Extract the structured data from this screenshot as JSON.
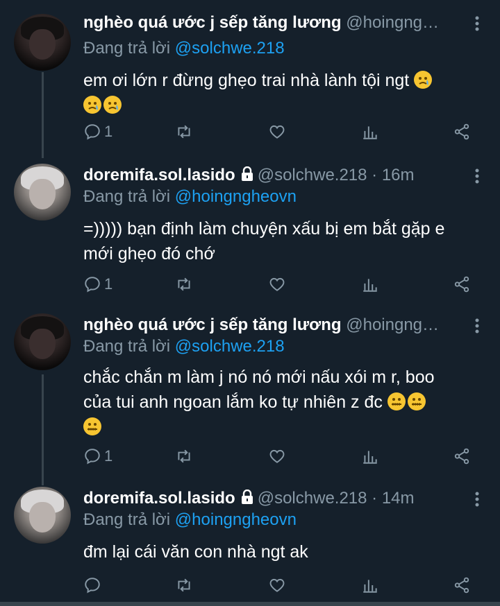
{
  "colors": {
    "background": "#15202b",
    "text": "#ffffff",
    "secondary": "#8899a6",
    "link": "#1da1f2",
    "thread_line": "#38444d"
  },
  "tweets": [
    {
      "name": "nghèo quá ước j sếp tăng lương",
      "handle": "@hoingng…",
      "locked": false,
      "time": "",
      "reply_prefix": "Đang trả lời ",
      "reply_to": "@solchwe.218",
      "body_line1": "em ơi lớn r đừng ghẹo trai nhà lành tội ngt",
      "body_line2": "",
      "reply_count": "1",
      "avatar": "dark",
      "emoji": "crying-face"
    },
    {
      "name": "doremifa.sol.lasido",
      "handle": "@solchwe.218",
      "locked": true,
      "time": " · 16m",
      "reply_prefix": "Đang trả lời ",
      "reply_to": "@hoingngheovn",
      "body_line1": "=))))) bạn định làm chuyện xấu bị em bắt gặp e",
      "body_line2": "mới ghẹo đó chớ",
      "reply_count": "1",
      "avatar": "light"
    },
    {
      "name": "nghèo quá ước j sếp tăng lương",
      "handle": "@hoingng…",
      "locked": false,
      "time": "",
      "reply_prefix": "Đang trả lời ",
      "reply_to": "@solchwe.218",
      "body_line1": "chắc chắn m làm j nó nó mới nấu xói m r, boo",
      "body_line2": "của tui anh ngoan lắm ko tự nhiên z đc",
      "reply_count": "1",
      "avatar": "dark",
      "emoji": "zipper-mouth-face"
    },
    {
      "name": "doremifa.sol.lasido",
      "handle": "@solchwe.218",
      "locked": true,
      "time": " · 14m",
      "reply_prefix": "Đang trả lời ",
      "reply_to": "@hoingngheovn",
      "body_line1": "đm lại cái văn con nhà ngt ak",
      "body_line2": "",
      "reply_count": "",
      "avatar": "light"
    }
  ]
}
